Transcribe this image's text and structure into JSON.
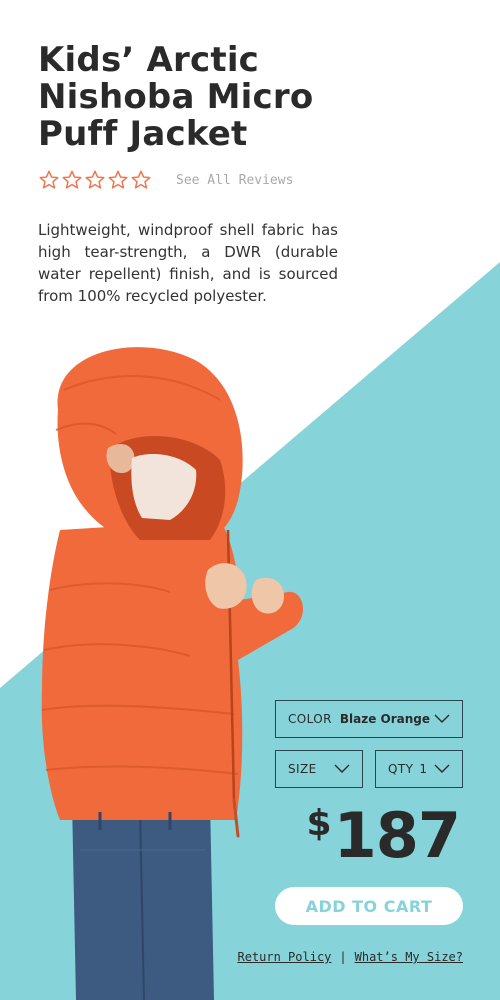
{
  "product": {
    "title": "Kids’ Arctic Nishoba Micro Puff Jacket",
    "rating": {
      "stars_filled": 0,
      "stars_total": 5,
      "reviews_link": "See All Reviews"
    },
    "description": "Lightweight, windproof shell fabric has high tear-strength, a DWR (durable water repellent) finish, and is sourced from 100% recycled polyester."
  },
  "options": {
    "color": {
      "label": "COLOR",
      "value": "Blaze Orange"
    },
    "size": {
      "label": "SIZE",
      "value": ""
    },
    "qty": {
      "label": "QTY",
      "value": "1"
    }
  },
  "price": {
    "currency": "$",
    "amount": "187"
  },
  "cart": {
    "button_label": "ADD TO CART"
  },
  "footer": {
    "return_policy": "Return Policy",
    "separator": "|",
    "size_guide": "What’s My Size?"
  },
  "icons": {
    "star": "star-outline-icon",
    "chevron": "chevron-down-icon"
  },
  "colors": {
    "accent_teal": "#86d3da",
    "star_orange": "#f0734a",
    "jacket_orange": "#f06a3c",
    "text_dark": "#2a2a2a",
    "muted_gray": "#a9a9a9"
  }
}
